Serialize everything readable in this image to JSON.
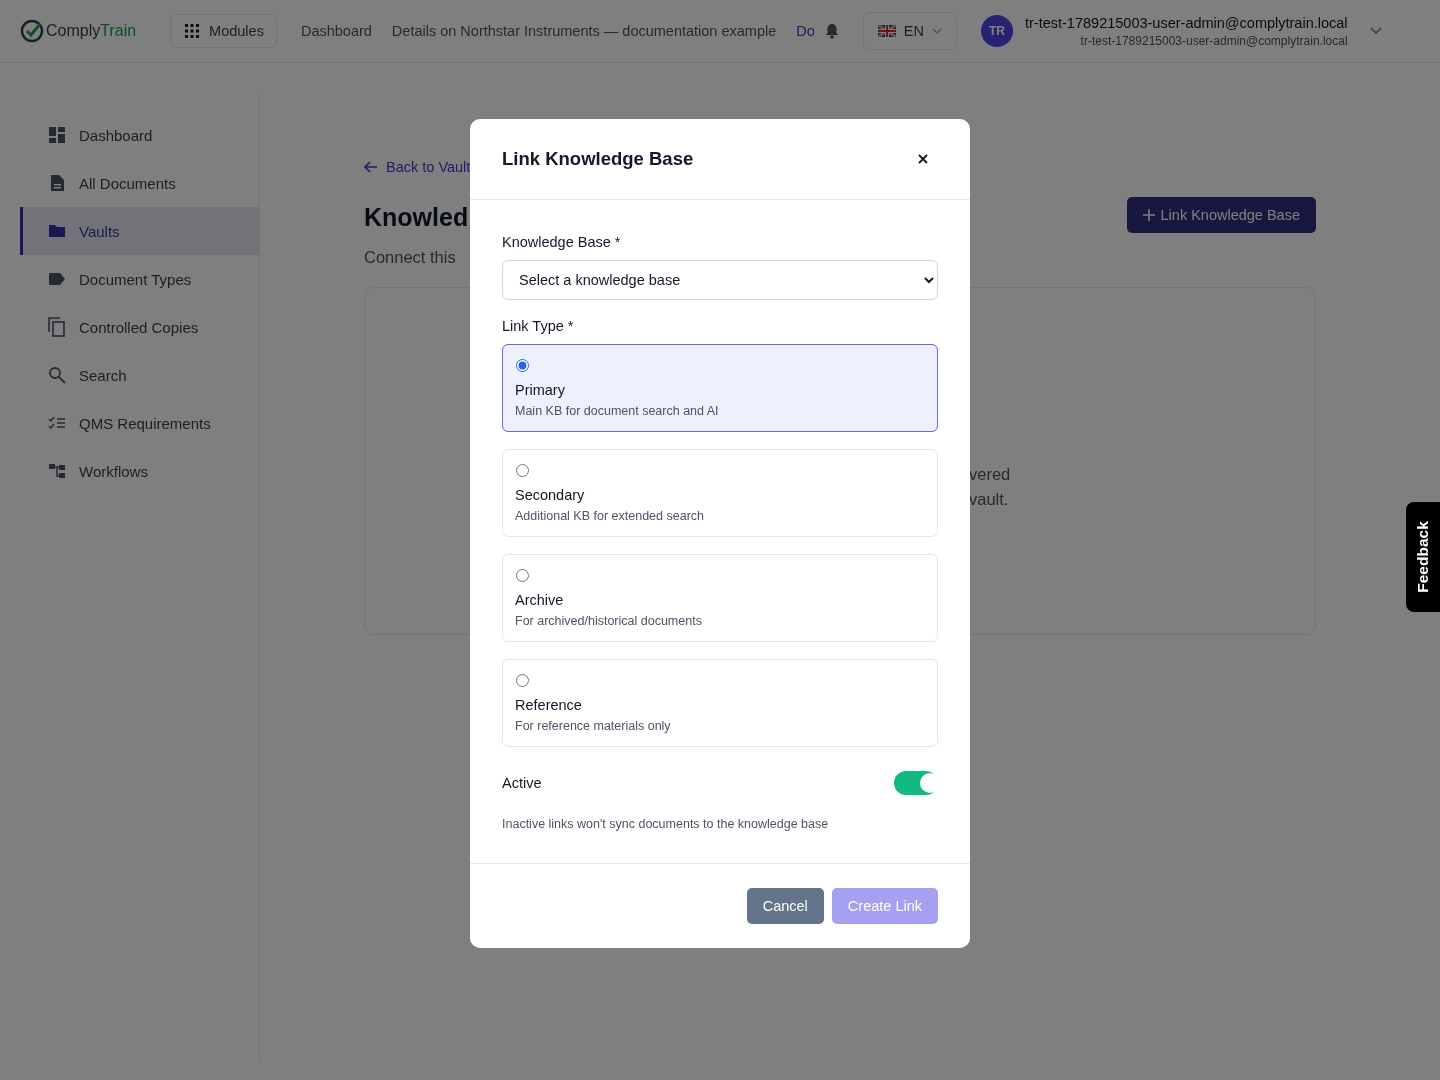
{
  "topbar": {
    "logo": {
      "part1": "Comply",
      "part2": "Train"
    },
    "modules_button": "Modules",
    "breadcrumbs": [
      "Dashboard",
      "Details on Northstar Instruments — documentation example"
    ],
    "cut_link": "Do",
    "language": "EN",
    "avatar_initials": "TR",
    "user_name": "tr-test-1789215003-user-admin@complytrain.local",
    "user_email": "tr-test-1789215003-user-admin@complytrain.local"
  },
  "sidebar": {
    "items": [
      {
        "label": "Dashboard",
        "kind": "dashboard",
        "selected": false
      },
      {
        "label": "All Documents",
        "kind": "document",
        "selected": false
      },
      {
        "label": "Vaults",
        "kind": "folder",
        "selected": true
      },
      {
        "label": "Document Types",
        "kind": "tag",
        "selected": false
      },
      {
        "label": "Controlled Copies",
        "kind": "copies",
        "selected": false
      },
      {
        "label": "Search",
        "kind": "search",
        "selected": false
      },
      {
        "label": "QMS Requirements",
        "kind": "checklist",
        "selected": false
      },
      {
        "label": "Workflows",
        "kind": "workflow",
        "selected": false
      }
    ]
  },
  "main": {
    "back_link": "Back to Vault",
    "title": "Knowled",
    "subtitle": "Connect this",
    "link_button": "Link Knowledge Base",
    "empty_text": [
      "vered",
      "vault."
    ]
  },
  "modal": {
    "title": "Link Knowledge Base",
    "knowledge_base": {
      "label": "Knowledge Base *",
      "value": "Select a knowledge base"
    },
    "link_type": {
      "label": "Link Type *",
      "options": [
        {
          "title": "Primary",
          "description": "Main KB for document search and AI",
          "selected": true
        },
        {
          "title": "Secondary",
          "description": "Additional KB for extended search",
          "selected": false
        },
        {
          "title": "Archive",
          "description": "For archived/historical documents",
          "selected": false
        },
        {
          "title": "Reference",
          "description": "For reference materials only",
          "selected": false
        }
      ]
    },
    "active": {
      "label": "Active",
      "hint": "Inactive links won't sync documents to the knowledge base",
      "on": true
    },
    "buttons": [
      {
        "label": "Cancel",
        "kind": "secondary",
        "disabled": false
      },
      {
        "label": "Create Link",
        "kind": "primary",
        "disabled": true
      }
    ]
  },
  "feedback": "Feedback"
}
